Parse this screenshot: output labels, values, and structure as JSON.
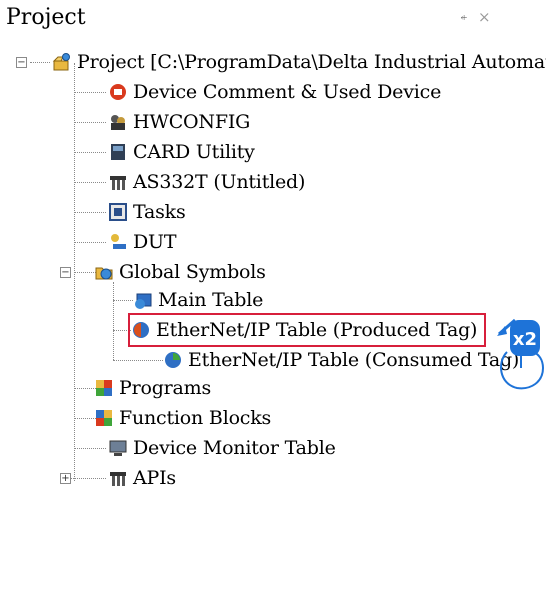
{
  "panel": {
    "title": "Project",
    "pin_glyph": "⍅",
    "close_glyph": "×"
  },
  "tree": {
    "root": {
      "label": "Project [C:\\ProgramData\\Delta Industrial Automat",
      "icon": "project-icon",
      "expanded": true
    },
    "items": [
      {
        "label": "Device Comment & Used Device",
        "icon": "device-comment-icon"
      },
      {
        "label": "HWCONFIG",
        "icon": "hwconfig-icon"
      },
      {
        "label": "CARD Utility",
        "icon": "card-utility-icon"
      },
      {
        "label": "AS332T  (Untitled)",
        "icon": "plc-icon"
      },
      {
        "label": "Tasks",
        "icon": "tasks-icon"
      },
      {
        "label": "DUT",
        "icon": "dut-icon"
      },
      {
        "label": "Global Symbols",
        "icon": "global-symbols-icon",
        "expanded": true
      },
      {
        "label": "Main Table",
        "icon": "table-icon"
      },
      {
        "label": "EtherNet/IP Table (Produced Tag)",
        "icon": "ethernet-ip-produced-icon",
        "selected": true
      },
      {
        "label": "EtherNet/IP Table (Consumed Tag)",
        "icon": "ethernet-ip-consumed-icon"
      },
      {
        "label": "Programs",
        "icon": "programs-icon"
      },
      {
        "label": "Function Blocks",
        "icon": "function-blocks-icon"
      },
      {
        "label": "Device Monitor Table",
        "icon": "monitor-icon"
      },
      {
        "label": "APIs",
        "icon": "apis-icon",
        "expanded": false
      }
    ]
  },
  "annotation": {
    "double_click_label": "x2",
    "highlight_color": "#d71f3b",
    "accent_color": "#1e73d8"
  }
}
